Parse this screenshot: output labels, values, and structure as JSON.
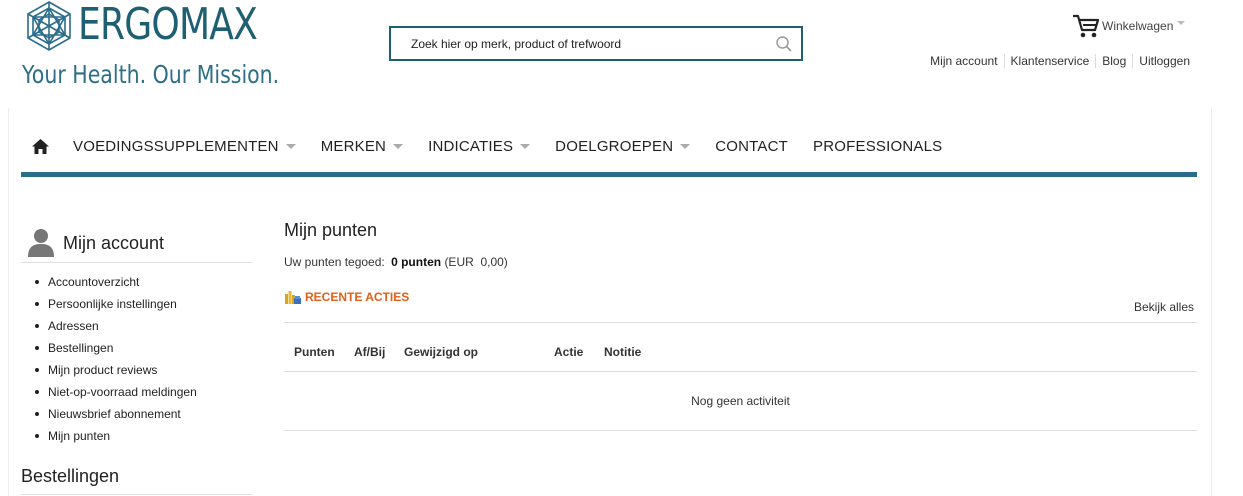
{
  "header": {
    "logo_name": "ERGOMAX",
    "logo_tagline": "Your Health. Our Mission.",
    "search_placeholder": "Zoek hier op merk, product of trefwoord",
    "search_icon": "search-icon",
    "cart_label": "Winkelwagen",
    "cart_icon": "cart-icon",
    "links": [
      "Mijn account",
      "Klantenservice",
      "Blog",
      "Uitloggen"
    ]
  },
  "nav": {
    "home_icon": "home-icon",
    "items": [
      {
        "label": "VOEDINGSSUPPLEMENTEN",
        "dropdown": true
      },
      {
        "label": "MERKEN",
        "dropdown": true
      },
      {
        "label": "INDICATIES",
        "dropdown": true
      },
      {
        "label": "DOELGROEPEN",
        "dropdown": true
      },
      {
        "label": "CONTACT",
        "dropdown": false
      },
      {
        "label": "PROFESSIONALS",
        "dropdown": false
      }
    ]
  },
  "sidebar": {
    "title": "Mijn account",
    "user_icon": "user-icon",
    "items": [
      "Accountoverzicht",
      "Persoonlijke instellingen",
      "Adressen",
      "Bestellingen",
      "Mijn product reviews",
      "Niet-op-voorraad meldingen",
      "Nieuwsbrief abonnement",
      "Mijn punten"
    ],
    "section2_title": "Bestellingen"
  },
  "main": {
    "title": "Mijn punten",
    "balance_prefix": "Uw punten tegoed:",
    "balance_points": "0 punten",
    "balance_currency": "(EUR  0,00)",
    "recent_label": "RECENTE ACTIES",
    "recent_icon": "coins-icon",
    "view_all": "Bekijk alles",
    "table": {
      "columns": [
        "Punten",
        "Af/Bij",
        "Gewijzigd op",
        "Actie",
        "Notitie"
      ],
      "empty_text": "Nog geen activiteit"
    }
  },
  "colors": {
    "brand": "#1f5f72",
    "nav_bar": "#2a6c8c",
    "accent_orange": "#e0601a"
  }
}
